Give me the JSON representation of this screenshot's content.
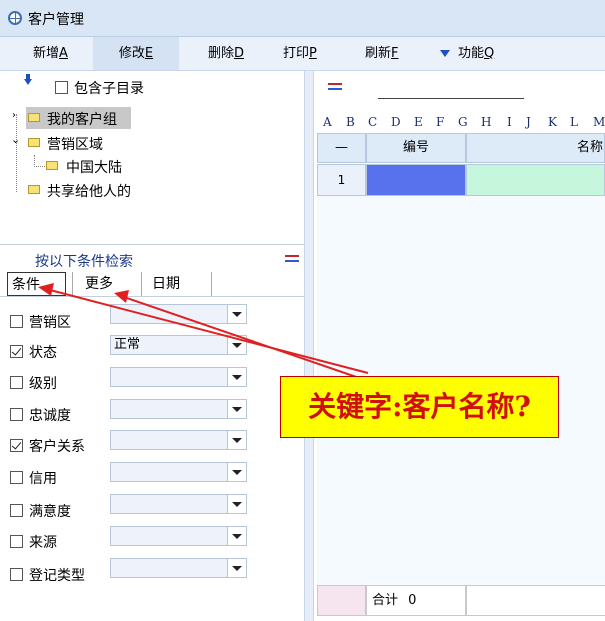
{
  "window": {
    "title": "客户管理"
  },
  "toolbar": {
    "new": {
      "label": "新增",
      "key": "A"
    },
    "edit": {
      "label": "修改",
      "key": "E"
    },
    "delete": {
      "label": "删除",
      "key": "D"
    },
    "print": {
      "label": "打印",
      "key": "P"
    },
    "refresh": {
      "label": "刷新",
      "key": "F"
    },
    "function": {
      "label": "功能",
      "key": "Q"
    }
  },
  "tree": {
    "include_subdir": "包含子目录",
    "items": [
      {
        "label": "我的客户组",
        "selected": true
      },
      {
        "label": "营销区域"
      },
      {
        "label": "中国大陆"
      },
      {
        "label": "共享给他人的"
      }
    ]
  },
  "search": {
    "heading": "按以下条件检索",
    "tabs": [
      "条件",
      "更多",
      "日期"
    ],
    "filters": [
      {
        "label": "营销区",
        "checked": false,
        "value": ""
      },
      {
        "label": "状态",
        "checked": true,
        "value": "正常"
      },
      {
        "label": "级别",
        "checked": false,
        "value": ""
      },
      {
        "label": "忠诚度",
        "checked": false,
        "value": ""
      },
      {
        "label": "客户关系",
        "checked": true,
        "value": ""
      },
      {
        "label": "信用",
        "checked": false,
        "value": ""
      },
      {
        "label": "满意度",
        "checked": false,
        "value": ""
      },
      {
        "label": "来源",
        "checked": false,
        "value": ""
      },
      {
        "label": "登记类型",
        "checked": false,
        "value": ""
      }
    ]
  },
  "grid": {
    "column_letters": [
      "A",
      "B",
      "C",
      "D",
      "E",
      "F",
      "G",
      "H",
      "I",
      "J",
      "K",
      "L",
      "M"
    ],
    "header": {
      "corner": "—",
      "col1": "编号",
      "col2": "名称"
    },
    "rows": [
      {
        "num": "1"
      }
    ],
    "footer": {
      "total_label": "合计",
      "total_value": "0"
    }
  },
  "annotation": {
    "text": "关键字:客户名称?"
  },
  "colors": {
    "accent": "#2a5bd4",
    "selected_cell": "#5872ee",
    "row_fill": "#c6f6dc",
    "callout_bg": "#ffff00",
    "callout_text": "#d01010",
    "arrow": "#e02020"
  }
}
